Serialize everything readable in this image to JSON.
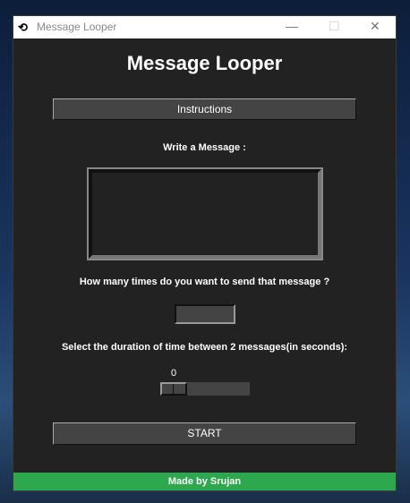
{
  "window": {
    "title": "Message Looper",
    "app_icon": "loop-arrows-icon"
  },
  "main": {
    "heading": "Message Looper",
    "instructions_label": "Instructions",
    "message_label": "Write a Message :",
    "message_value": "",
    "count_label": "How many times do you want to send that message ?",
    "count_value": "",
    "duration_label": "Select the duration of time between 2 messages(in seconds):",
    "duration_value": "0",
    "start_label": "START"
  },
  "footer": {
    "text": "Made by Srujan"
  }
}
